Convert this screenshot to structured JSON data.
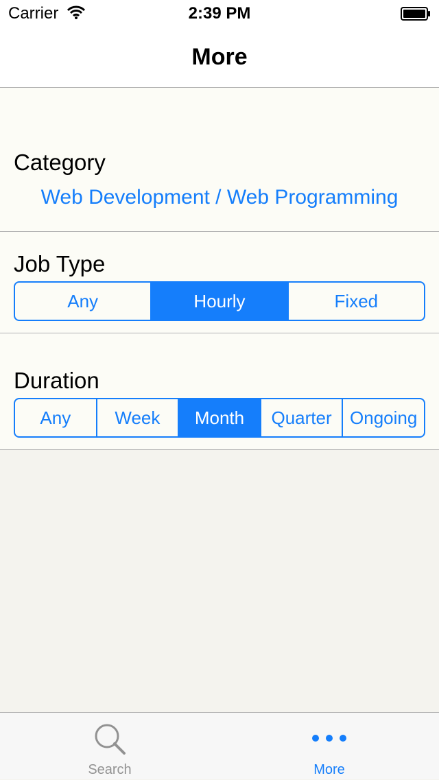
{
  "status_bar": {
    "carrier": "Carrier",
    "time": "2:39 PM"
  },
  "nav": {
    "title": "More"
  },
  "category": {
    "label": "Category",
    "value": "Web Development / Web Programming"
  },
  "job_type": {
    "label": "Job Type",
    "options": [
      "Any",
      "Hourly",
      "Fixed"
    ],
    "selected": "Hourly"
  },
  "duration": {
    "label": "Duration",
    "options": [
      "Any",
      "Week",
      "Month",
      "Quarter",
      "Ongoing"
    ],
    "selected": "Month"
  },
  "tab_bar": {
    "items": [
      {
        "label": "Search",
        "icon": "search-icon",
        "active": false
      },
      {
        "label": "More",
        "icon": "more-icon",
        "active": true
      }
    ]
  },
  "colors": {
    "accent": "#157efb",
    "inactive": "#929292",
    "content_bg": "#fcfcf6",
    "page_bg": "#f4f3ee"
  }
}
